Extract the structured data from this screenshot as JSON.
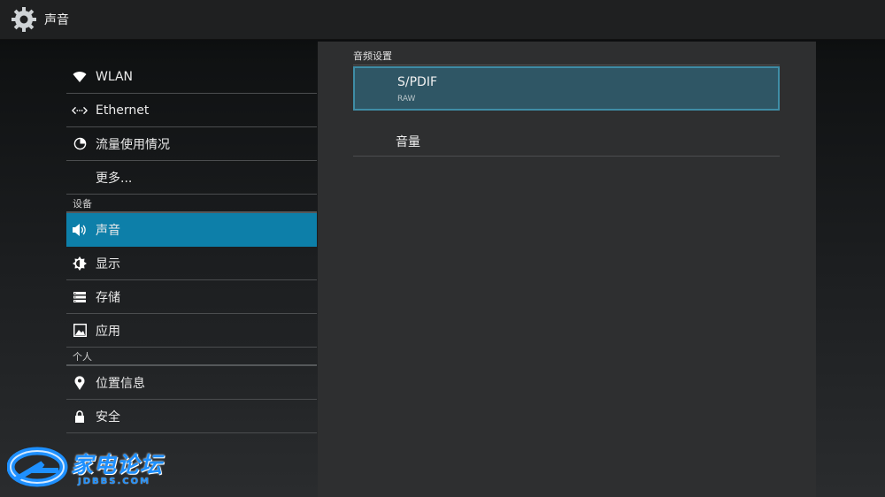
{
  "header": {
    "title": "声音",
    "icon": "gear-icon"
  },
  "sidebar": {
    "items": [
      {
        "label": "WLAN",
        "icon": "wifi-icon"
      },
      {
        "label": "Ethernet",
        "icon": "ethernet-icon"
      },
      {
        "label": "流量使用情况",
        "icon": "data-usage-icon"
      },
      {
        "label": "更多...",
        "icon": ""
      }
    ],
    "section_device": "设备",
    "device_items": [
      {
        "label": "声音",
        "icon": "speaker-icon",
        "selected": true
      },
      {
        "label": "显示",
        "icon": "brightness-icon"
      },
      {
        "label": "存储",
        "icon": "storage-icon"
      },
      {
        "label": "应用",
        "icon": "apps-icon"
      }
    ],
    "section_personal": "个人",
    "personal_items": [
      {
        "label": "位置信息",
        "icon": "location-pin-icon"
      },
      {
        "label": "安全",
        "icon": "lock-icon"
      }
    ]
  },
  "panel": {
    "category": "音频设置",
    "prefs": [
      {
        "title": "S/PDIF",
        "summary": "RAW"
      },
      {
        "title": "音量"
      }
    ]
  },
  "watermark": {
    "text": "家电论坛",
    "sub": "JDBBS.COM"
  },
  "colors": {
    "selected": "#0d7fa9",
    "focus_border": "#3f8da6",
    "panel": "#2e2f30"
  }
}
